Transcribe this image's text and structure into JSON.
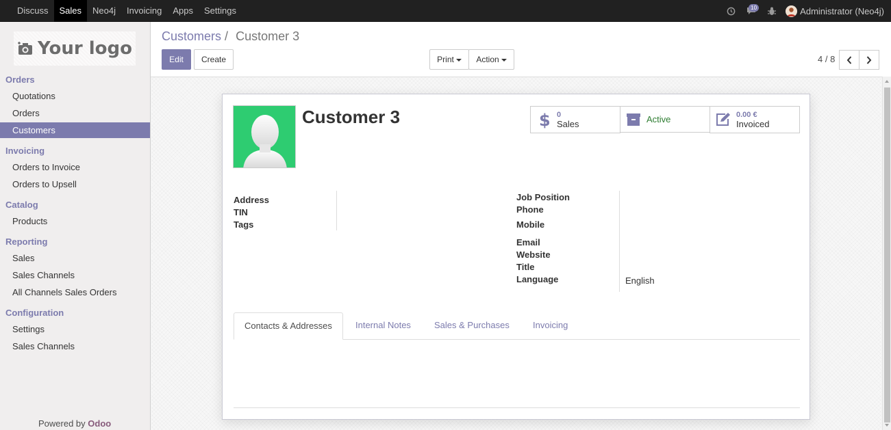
{
  "topbar": {
    "menu": [
      "Discuss",
      "Sales",
      "Neo4j",
      "Invoicing",
      "Apps",
      "Settings"
    ],
    "active": "Sales",
    "message_count": "10",
    "user": "Administrator (Neo4j)"
  },
  "sidebar": {
    "logo_text": "Your logo",
    "sections": [
      {
        "title": "Orders",
        "items": [
          "Quotations",
          "Orders",
          "Customers"
        ]
      },
      {
        "title": "Invoicing",
        "items": [
          "Orders to Invoice",
          "Orders to Upsell"
        ]
      },
      {
        "title": "Catalog",
        "items": [
          "Products"
        ]
      },
      {
        "title": "Reporting",
        "items": [
          "Sales",
          "Sales Channels",
          "All Channels Sales Orders"
        ]
      },
      {
        "title": "Configuration",
        "items": [
          "Settings",
          "Sales Channels"
        ]
      }
    ],
    "active_item": "Customers",
    "powered_prefix": "Powered by",
    "powered_brand": "Odoo"
  },
  "control": {
    "breadcrumb_parent": "Customers",
    "breadcrumb_sep": "/",
    "breadcrumb_current": "Customer 3",
    "edit_label": "Edit",
    "create_label": "Create",
    "print_label": "Print",
    "action_label": "Action",
    "pager": "4 / 8"
  },
  "record": {
    "name": "Customer 3",
    "smart_buttons": {
      "sales_value": "0",
      "sales_label": "Sales",
      "active_label": "Active",
      "invoiced_value": "0.00 €",
      "invoiced_label": "Invoiced"
    },
    "left_fields": [
      "Address",
      "TIN",
      "Tags"
    ],
    "right_fields": [
      "Job Position",
      "Phone",
      "Mobile",
      "Email",
      "Website",
      "Title",
      "Language"
    ],
    "language_value": "English",
    "tabs": [
      "Contacts & Addresses",
      "Internal Notes",
      "Sales & Purchases",
      "Invoicing"
    ],
    "active_tab": "Contacts & Addresses"
  },
  "colors": {
    "brand": "#7c7bad",
    "topbar": "#212121",
    "active_green": "#2e7d32",
    "avatar_green": "#2ecc71",
    "odoo": "#875a7b"
  }
}
